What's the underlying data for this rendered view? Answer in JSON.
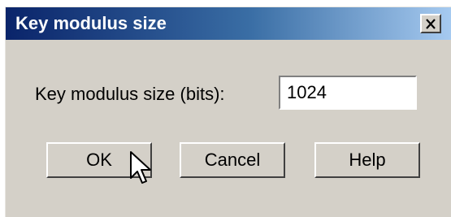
{
  "window": {
    "title": "Key modulus size",
    "close_icon": "close-x-icon"
  },
  "form": {
    "label": "Key modulus size (bits):",
    "value": "1024"
  },
  "buttons": {
    "ok": "OK",
    "cancel": "Cancel",
    "help": "Help"
  },
  "cursor": {
    "icon": "mouse-pointer-icon"
  }
}
